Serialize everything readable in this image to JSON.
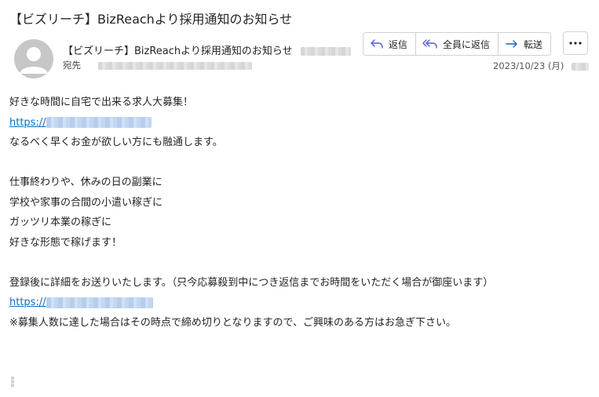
{
  "email": {
    "subject": "【ビズリーチ】BizReachより採用通知のお知らせ",
    "sender_name": "【ビズリーチ】BizReachより採用通知のお知らせ",
    "to_label": "宛先",
    "date": "2023/10/23 (月)"
  },
  "actions": {
    "reply": "返信",
    "reply_all": "全員に返信",
    "forward": "転送"
  },
  "icons": {
    "reply": "reply-arrow-icon",
    "reply_all": "reply-all-arrow-icon",
    "forward": "forward-arrow-icon",
    "more": "ellipsis-icon",
    "avatar": "person-icon"
  },
  "colors": {
    "link": "#0f6cbd",
    "accent": "#5b5fc7",
    "text": "#242424"
  },
  "body": {
    "line1": "好きな時間に自宅で出来る求人大募集！",
    "link1_prefix": "https://",
    "line2": "なるべく早くお金が欲しい方にも融通します。",
    "line3": "仕事終わりや、休みの日の副業に",
    "line4": "学校や家事の合間の小遣い稼ぎに",
    "line5": "ガッツリ本業の稼ぎに",
    "line6": "好きな形態で稼げます！",
    "line7": "登録後に詳細をお送りいたします。（只今応募殺到中につき返信までお時間をいただく場合が御座います）",
    "link2_prefix": "https://",
    "line8": "※募集人数に達した場合はその時点で締め切りとなりますので、ご興味のある方はお急ぎ下さい。"
  }
}
